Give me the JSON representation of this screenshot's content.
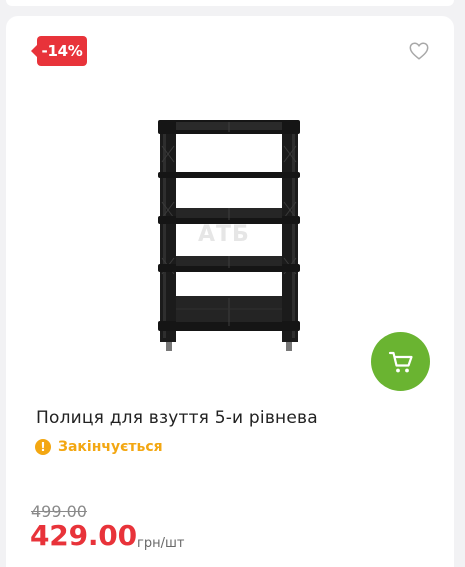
{
  "product": {
    "discount_badge": "-14%",
    "title": "Полиця для взуття 5-и рівнева",
    "stock_status": "Закінчується",
    "stock_icon_glyph": "!",
    "old_price": "499.00",
    "new_price": "429.00",
    "unit": "грн/шт",
    "watermark": "АТБ"
  },
  "icons": {
    "favorite": "heart-outline-icon",
    "cart": "shopping-cart-icon",
    "stock": "warning-circle-icon"
  },
  "colors": {
    "discount": "#e8333a",
    "cart_button": "#6ab431",
    "stock_warning": "#f3a712",
    "price": "#e8333a"
  }
}
